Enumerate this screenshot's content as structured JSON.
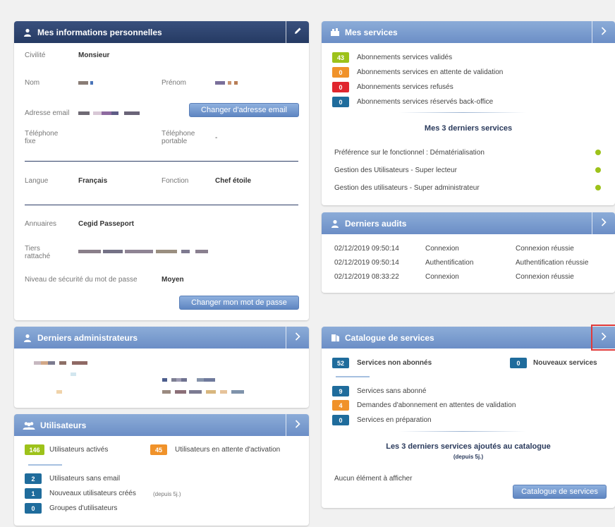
{
  "personal": {
    "title": "Mes informations personnelles",
    "civilite_label": "Civilité",
    "civilite_value": "Monsieur",
    "nom_label": "Nom",
    "prenom_label": "Prénom",
    "email_label": "Adresse email",
    "change_email_btn": "Changer d'adresse email",
    "tel_fixe_label": "Téléphone\nfixe",
    "tel_portable_label": "Téléphone\nportable",
    "tel_portable_value": "-",
    "langue_label": "Langue",
    "langue_value": "Français",
    "fonction_label": "Fonction",
    "fonction_value": "Chef étoile",
    "annuaires_label": "Annuaires",
    "annuaires_value": "Cegid Passeport",
    "tiers_label": "Tiers\nrattaché",
    "niveau_label": "Niveau de sécurité du mot de passe",
    "niveau_value": "Moyen",
    "change_pwd_btn": "Changer mon mot de passe"
  },
  "services": {
    "title": "Mes services",
    "stats": [
      {
        "count": "43",
        "label": "Abonnements services validés",
        "color": "#9dc21a"
      },
      {
        "count": "0",
        "label": "Abonnements services en attente de validation",
        "color": "#f0922a"
      },
      {
        "count": "0",
        "label": "Abonnements services refusés",
        "color": "#e0262e"
      },
      {
        "count": "0",
        "label": "Abonnements services réservés back-office",
        "color": "#1f6c9c"
      }
    ],
    "last_title": "Mes 3 derniers services",
    "last": [
      "Préférence sur le fonctionnel : Dématérialisation",
      "Gestion des Utilisateurs - Super lecteur",
      "Gestion des utilisateurs - Super administrateur"
    ]
  },
  "audits": {
    "title": "Derniers audits",
    "rows": [
      {
        "date": "02/12/2019 09:50:14",
        "type": "Connexion",
        "result": "Connexion réussie"
      },
      {
        "date": "02/12/2019 09:50:14",
        "type": "Authentification",
        "result": "Authentification réussie"
      },
      {
        "date": "02/12/2019 08:33:22",
        "type": "Connexion",
        "result": "Connexion réussie"
      }
    ]
  },
  "admins": {
    "title": "Derniers administrateurs"
  },
  "users": {
    "title": "Utilisateurs",
    "active_count": "146",
    "active_label": "Utilisateurs activés",
    "pending_count": "45",
    "pending_label": "Utilisateurs en attente d'activation",
    "no_email_count": "2",
    "no_email_label": "Utilisateurs sans email",
    "new_count": "1",
    "new_label": "Nouveaux utilisateurs créés",
    "new_note": "(depuis 5j.)",
    "groups_count": "0",
    "groups_label": "Groupes d'utilisateurs"
  },
  "catalog": {
    "title": "Catalogue de services",
    "non_sub_count": "52",
    "non_sub_label": "Services non abonnés",
    "new_count": "0",
    "new_label": "Nouveaux services",
    "no_sub_count": "9",
    "no_sub_label": "Services sans abonné",
    "req_count": "4",
    "req_label": "Demandes d'abonnement en attentes de validation",
    "prep_count": "0",
    "prep_label": "Services en préparation",
    "last_title": "Les 3 derniers services ajoutés au catalogue",
    "last_sub": "(depuis 5j.)",
    "empty": "Aucun élément à afficher",
    "btn": "Catalogue de services"
  },
  "colors": {
    "header_dark": "#253a63",
    "header_light": "#6b8ec6",
    "green": "#9dc21a",
    "orange": "#f0922a",
    "red": "#e0262e",
    "blue": "#1f6c9c"
  }
}
